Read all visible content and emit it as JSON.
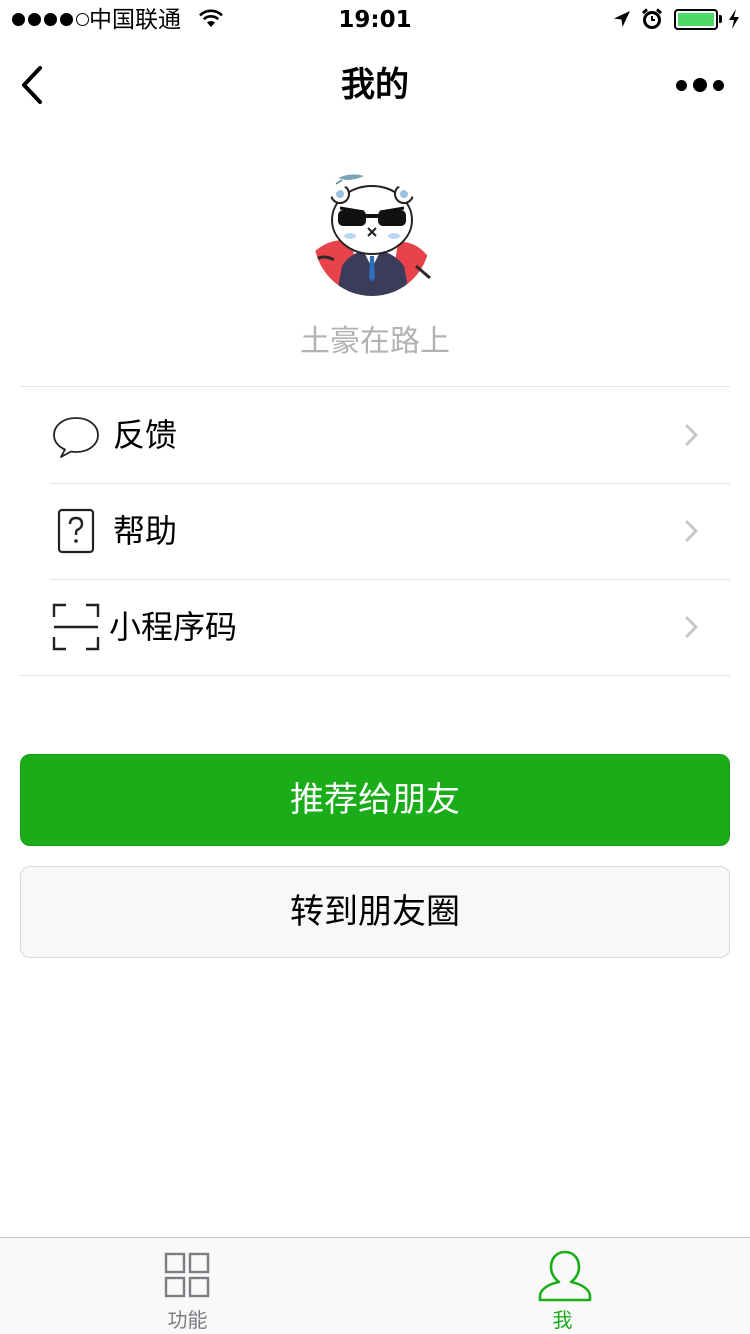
{
  "status_bar": {
    "carrier": "中国联通",
    "time": "19:01"
  },
  "nav": {
    "title": "我的"
  },
  "profile": {
    "username": "土豪在路上"
  },
  "menu": {
    "items": [
      {
        "label": "反馈",
        "icon": "chat-bubble-icon"
      },
      {
        "label": "帮助",
        "icon": "help-icon"
      },
      {
        "label": "小程序码",
        "icon": "scan-code-icon"
      }
    ]
  },
  "actions": {
    "recommend_label": "推荐给朋友",
    "share_moments_label": "转到朋友圈"
  },
  "tab_bar": {
    "tabs": [
      {
        "label": "功能",
        "icon": "grid-icon",
        "active": false
      },
      {
        "label": "我",
        "icon": "person-icon",
        "active": true
      }
    ]
  },
  "colors": {
    "primary": "#1aad19",
    "tab_inactive": "#7a7e83",
    "username": "#b2b2b2",
    "battery": "#4cd964"
  }
}
